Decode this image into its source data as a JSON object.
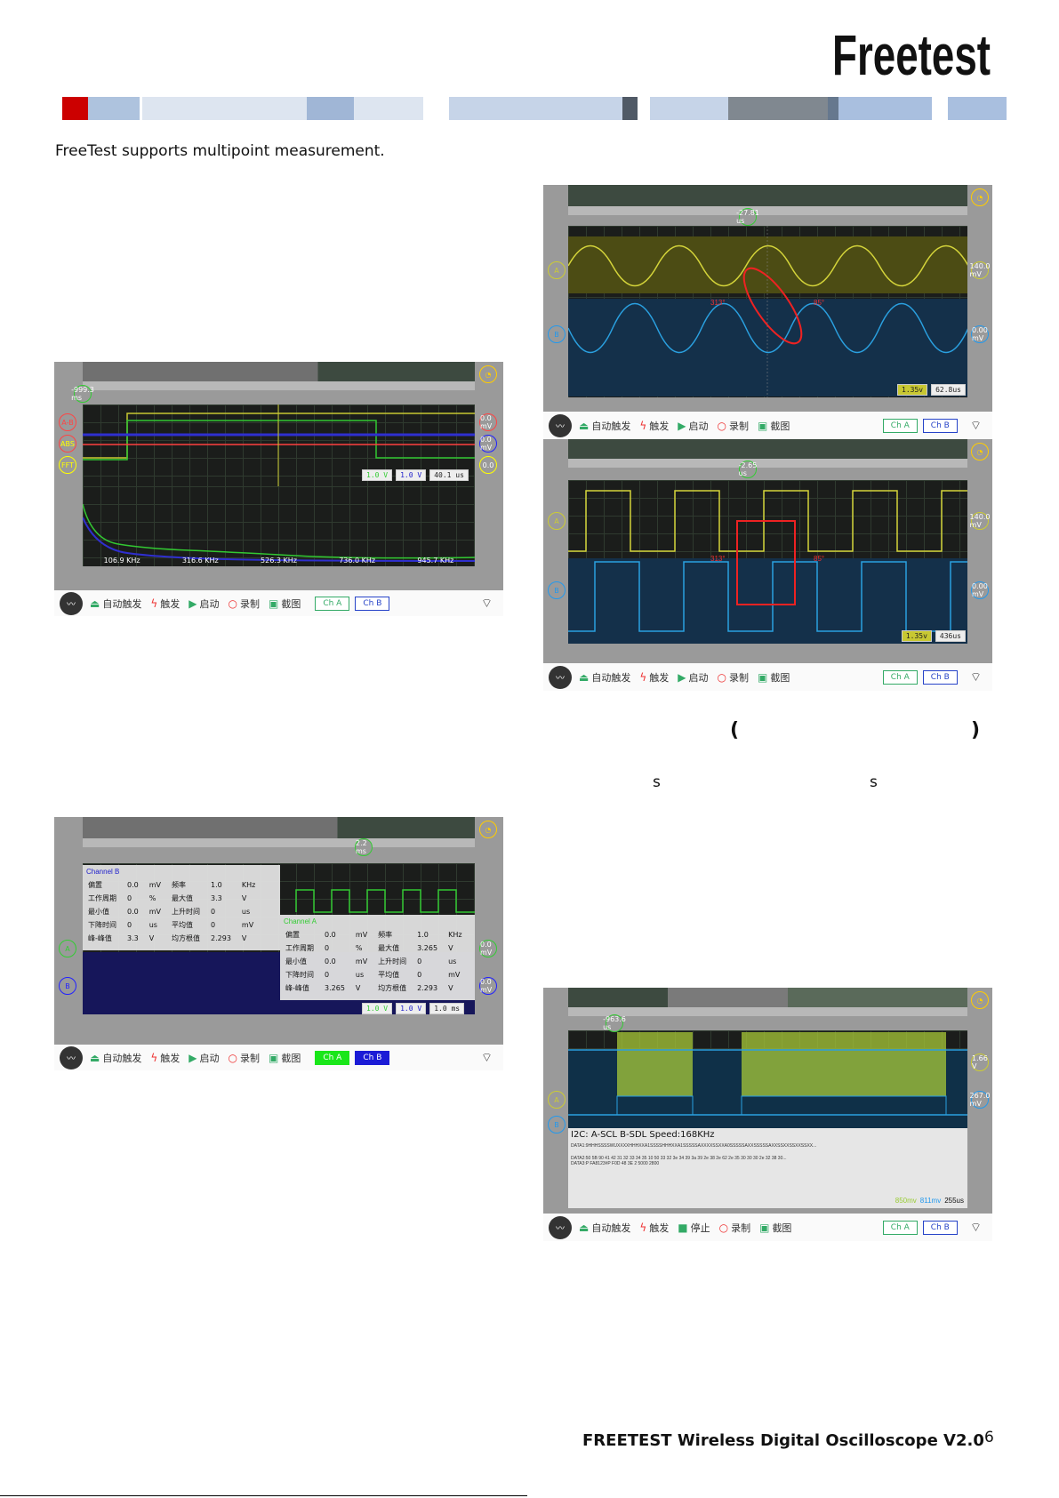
{
  "header": {
    "logo_text": "Freetest",
    "band_colors": [
      "#cc0000",
      "#aec3de",
      "#dde5f0",
      "#a0b6d6",
      "#dde5f0",
      "#c6d4e8",
      "#505a66",
      "#c6d4e8",
      "#808890",
      "#a9bfdf"
    ]
  },
  "intro_text": "FreeTest supports multipoint measurement.",
  "parens": {
    "open": "(",
    "close": ")"
  },
  "s_chars": [
    "s",
    "s"
  ],
  "footer": {
    "title": "FREETEST Wireless Digital Oscilloscope V2.0",
    "page_number": "6"
  },
  "toolbar": {
    "auto_trigger": "自动触发",
    "trigger": "触发",
    "start": "启动",
    "stop": "停止",
    "record": "录制",
    "screenshot": "截图",
    "ch_a": "Ch A",
    "ch_b": "Ch B"
  },
  "shot1": {
    "trigger_level": "-999.3 ms",
    "labels": [
      "A-B",
      "ABS",
      "FFT"
    ],
    "right_labels": [
      "0.0 mV",
      "0.0 mV",
      "0.0"
    ],
    "readouts": [
      "1.0 V",
      "1.0 V",
      "40.1 us"
    ],
    "fft_ticks": [
      "106.9 KHz",
      "316.6 KHz",
      "526.3 KHz",
      "736.0 KHz",
      "945.7 KHz"
    ]
  },
  "shot2": {
    "trigger_level": "-27.81 us",
    "labels": [
      "A",
      "B"
    ],
    "right_labels": [
      "140.0 mV",
      "0.00 mV"
    ],
    "marks": [
      "313°",
      "85°"
    ],
    "readouts": [
      "1.35v",
      "62.8us"
    ]
  },
  "shot3": {
    "trigger_level": "-2.65 us",
    "labels": [
      "A",
      "B"
    ],
    "right_labels": [
      "140.0 mV",
      "0.00 mV"
    ],
    "marks": [
      "313°",
      "85°"
    ],
    "readouts": [
      "1.35v",
      "436us"
    ]
  },
  "shot4": {
    "trigger_level": "2.2 ms",
    "labels": [
      "A",
      "B"
    ],
    "right_labels": [
      "0.0 mV",
      "0.0 mV"
    ],
    "readouts": [
      "1.0 V",
      "1.0 V",
      "1.0 ms"
    ],
    "table_b": {
      "title": "Channel B",
      "rows": [
        [
          "偏置",
          "0.0",
          "mV",
          "频率",
          "1.0",
          "KHz"
        ],
        [
          "工作周期",
          "0",
          "%",
          "最大值",
          "3.3",
          "V"
        ],
        [
          "最小值",
          "0.0",
          "mV",
          "上升时间",
          "0",
          "us"
        ],
        [
          "下降时间",
          "0",
          "us",
          "平均值",
          "0",
          "mV"
        ],
        [
          "峰-峰值",
          "3.3",
          "V",
          "均方根值",
          "2.293",
          "V"
        ]
      ]
    },
    "table_a": {
      "title": "Channel A",
      "rows": [
        [
          "偏置",
          "0.0",
          "mV",
          "频率",
          "1.0",
          "KHz"
        ],
        [
          "工作周期",
          "0",
          "%",
          "最大值",
          "3.265",
          "V"
        ],
        [
          "最小值",
          "0.0",
          "mV",
          "上升时间",
          "0",
          "us"
        ],
        [
          "下降时间",
          "0",
          "us",
          "平均值",
          "0",
          "mV"
        ],
        [
          "峰-峰值",
          "3.265",
          "V",
          "均方根值",
          "2.293",
          "V"
        ]
      ]
    }
  },
  "shot5": {
    "trigger_level": "-963.6 us",
    "labels": [
      "A",
      "B"
    ],
    "right_labels": [
      "1.66 V",
      "267.0 mV"
    ],
    "decode_title": "I2C: A-SCL  B-SDL  Speed:168KHz",
    "decode_lines": [
      "DATA1:9HHHSSSSWUXXXXHHHXXA1SSSSHHHXXA1SSSSSAXXXXSSXXA0SSSSSAXXSSSSSAXXSSXXSSXXSSXX...",
      "DATA2:50 5B 90 41 42 31 32 33 34 35 10 50 33 32 3e 34 39 3a 39 2e 38 2e 62 2e 35 30 30 30 2e 32 38 30...",
      "DATA3:P FA8123#P F0D 48 3E 2 5000 2800"
    ],
    "readouts": [
      "850mv",
      "811mv",
      "255us"
    ]
  }
}
